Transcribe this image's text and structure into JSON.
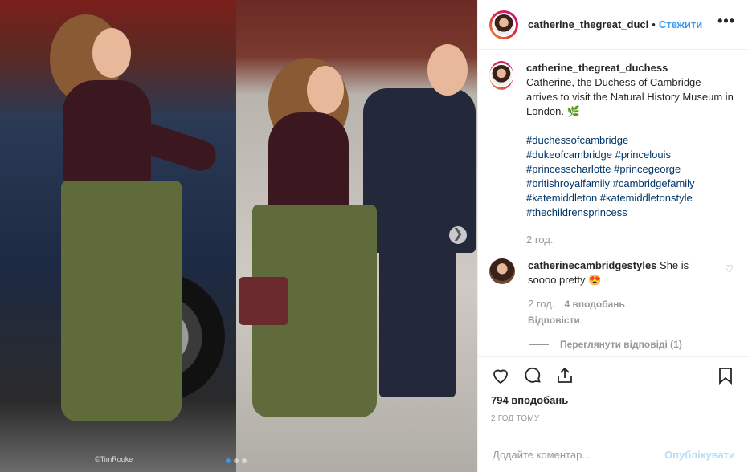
{
  "header": {
    "username": "catherine_thegreat_ducl",
    "separator": "•",
    "follow_label": "Стежити",
    "more_icon": "more-horizontal-icon"
  },
  "caption": {
    "username": "catherine_thegreat_duchess",
    "text": "Catherine, the Duchess of Cambridge arrives to visit the Natural History Museum in London. 🌿",
    "hashtags": [
      "#duchessofcambridge",
      "#dukeofcambridge",
      "#princelouis",
      "#princesscharlotte",
      "#princegeorge",
      "#britishroyalfamily",
      "#cambridgefamily",
      "#katemiddleton",
      "#katemiddletonstyle",
      "#thechildrensprincess"
    ],
    "time": "2 год."
  },
  "comment": {
    "username": "catherinecambridgestyles",
    "text": "She is soooo pretty 😍",
    "time": "2 год.",
    "likes": "4 вподобань",
    "reply_label": "Відповісти",
    "view_replies": "Переглянути відповіді (1)"
  },
  "post": {
    "likes": "794 вподобань",
    "date": "2 ГОД ТОМУ"
  },
  "add_comment": {
    "placeholder": "Додайте коментар...",
    "post_label": "Опублікувати"
  },
  "image": {
    "watermark": "©TimRooke",
    "slide_count": 3,
    "active_slide": 1
  },
  "colors": {
    "accent": "#3897f0",
    "hashtag": "#003569",
    "muted": "#999999",
    "post_disabled": "#b2dffc"
  }
}
